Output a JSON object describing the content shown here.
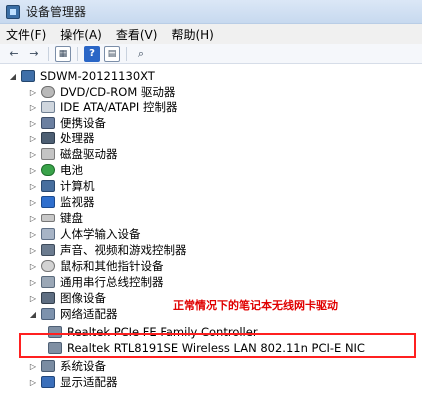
{
  "window": {
    "title": "设备管理器"
  },
  "menu": {
    "items": [
      "文件(F)",
      "操作(A)",
      "查看(V)",
      "帮助(H)"
    ]
  },
  "toolbar": {
    "back": "←",
    "forward": "→",
    "box1": "▦",
    "help": "?",
    "box2": "▤",
    "scan": "⌕"
  },
  "tree": {
    "root": "SDWM-20121130XT",
    "categories": [
      "DVD/CD-ROM 驱动器",
      "IDE ATA/ATAPI 控制器",
      "便携设备",
      "处理器",
      "磁盘驱动器",
      "电池",
      "计算机",
      "监视器",
      "键盘",
      "人体学输入设备",
      "声音、视频和游戏控制器",
      "鼠标和其他指针设备",
      "通用串行总线控制器",
      "图像设备",
      "网络适配器",
      "系统设备",
      "显示适配器"
    ],
    "network_children": [
      "Realtek PCIe FE Family Controller",
      "Realtek RTL8191SE Wireless LAN 802.11n PCI-E NIC"
    ]
  },
  "annotation": {
    "note": "正常情况下的笔记本无线网卡驱动",
    "highlight_color": "#ff2020"
  }
}
